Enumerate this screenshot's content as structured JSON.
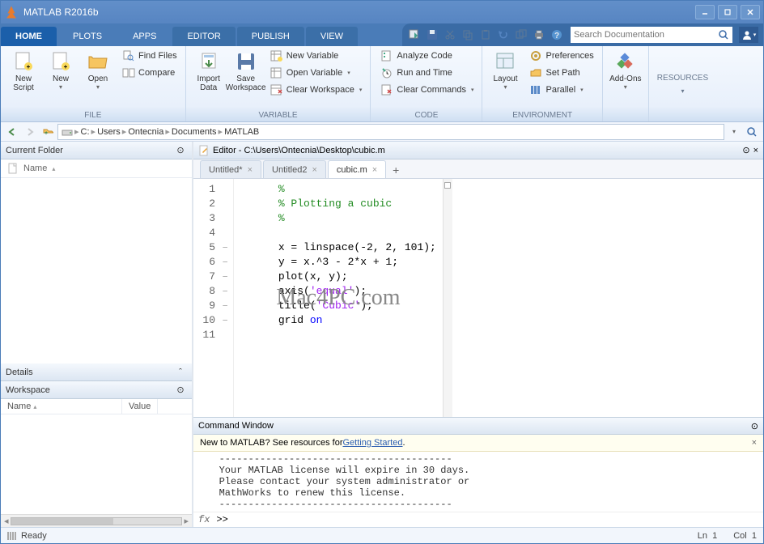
{
  "app": {
    "title": "MATLAB R2016b"
  },
  "tabs": {
    "home": "HOME",
    "plots": "PLOTS",
    "apps": "APPS",
    "editor": "EDITOR",
    "publish": "PUBLISH",
    "view": "VIEW"
  },
  "search": {
    "placeholder": "Search Documentation"
  },
  "ribbon": {
    "file": {
      "label": "FILE",
      "newScript": "New\nScript",
      "new": "New",
      "open": "Open",
      "findFiles": "Find Files",
      "compare": "Compare"
    },
    "data": {
      "import": "Import\nData",
      "save": "Save\nWorkspace"
    },
    "variable": {
      "label": "VARIABLE",
      "newVar": "New Variable",
      "openVar": "Open Variable",
      "clearWs": "Clear Workspace"
    },
    "code": {
      "label": "CODE",
      "analyze": "Analyze Code",
      "run": "Run and Time",
      "clear": "Clear Commands"
    },
    "env": {
      "label": "ENVIRONMENT",
      "layout": "Layout",
      "prefs": "Preferences",
      "setPath": "Set Path",
      "parallel": "Parallel"
    },
    "addons": "Add-Ons",
    "resources": "RESOURCES"
  },
  "path": {
    "seg0": "C:",
    "seg1": "Users",
    "seg2": "Ontecnia",
    "seg3": "Documents",
    "seg4": "MATLAB"
  },
  "panels": {
    "currentFolder": "Current Folder",
    "nameCol": "Name",
    "details": "Details",
    "workspace": "Workspace",
    "wsName": "Name",
    "wsValue": "Value"
  },
  "editor": {
    "title": "Editor - C:\\Users\\Ontecnia\\Desktop\\cubic.m",
    "tabs": {
      "t0": "Untitled*",
      "t1": "Untitled2",
      "t2": "cubic.m"
    },
    "lines": {
      "l1": "%",
      "l2": "% Plotting a cubic",
      "l3": "%",
      "l4": "",
      "l5a": "x = linspace(-2, 2, 101);",
      "l6a": "y = x.^3 - 2*x + 1;",
      "l7a": "plot(x, y);",
      "l8p": "axis(",
      "l8s": "'equal'",
      "l8e": ");",
      "l9p": "title(",
      "l9s": "'Cubic'",
      "l9e": ");",
      "l10a": "grid ",
      "l10k": "on"
    }
  },
  "watermark": "Mac4PC.com",
  "cw": {
    "title": "Command Window",
    "bannerPre": "New to MATLAB? See resources for ",
    "bannerLink": "Getting Started",
    "bannerPost": ".",
    "dashes": "----------------------------------------",
    "l1": "Your MATLAB license will expire in 30 days.",
    "l2": "Please contact your system administrator or",
    "l3": "MathWorks to renew this license.",
    "prompt": ">>"
  },
  "status": {
    "ready": "Ready",
    "ln": "Ln",
    "lnv": "1",
    "col": "Col",
    "colv": "1"
  }
}
